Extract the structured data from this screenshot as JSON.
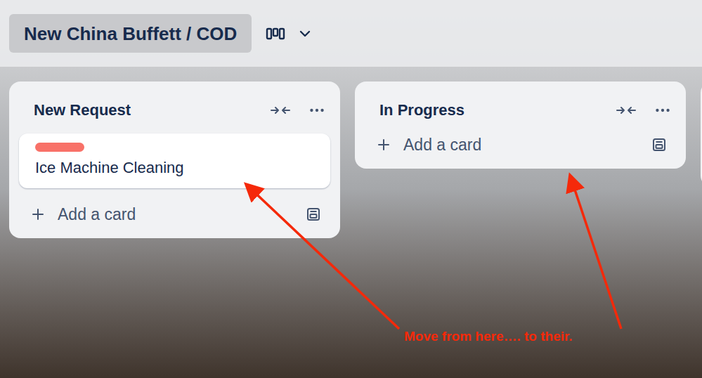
{
  "board": {
    "title": "New China Buffett / COD"
  },
  "lists": [
    {
      "title": "New Request",
      "cards": [
        {
          "title": "Ice Machine Cleaning",
          "labels": [
            {
              "color": "#f87168"
            }
          ]
        }
      ],
      "add_label": "Add a card"
    },
    {
      "title": "In Progress",
      "cards": [],
      "add_label": "Add a card"
    }
  ],
  "annotation": {
    "text": "Move from here…. to their."
  }
}
